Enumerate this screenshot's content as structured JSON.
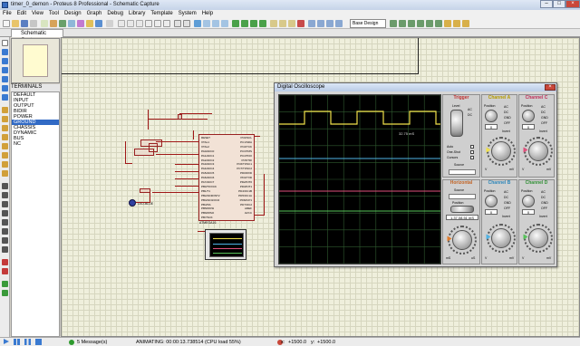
{
  "window": {
    "title": "timer_0_demon - Proteus 8 Professional - Schematic Capture"
  },
  "menu": [
    "File",
    "Edit",
    "View",
    "Tool",
    "Design",
    "Graph",
    "Debug",
    "Library",
    "Template",
    "System",
    "Help"
  ],
  "toolbar": {
    "design_select": "Base Design"
  },
  "tabs": {
    "active": "Schematic Capture"
  },
  "device_panel": {
    "header": "TERMINALS",
    "items": [
      "DEFAULT",
      "INPUT",
      "OUTPUT",
      "BIDIR",
      "POWER",
      "GROUND",
      "CHASSIS",
      "DYNAMIC",
      "BUS",
      "NC"
    ],
    "selected_index": 5
  },
  "schematic": {
    "chip_label": "ATMEGA16",
    "led_label": "LED-BLUE",
    "pins_left": [
      "RESET",
      "XTAL1",
      "XTAL2",
      "PA0/ADC0",
      "PA1/ADC1",
      "PA2/ADC2",
      "PA3/ADC3",
      "PA4/ADC4",
      "PA5/ADC5",
      "PA6/ADC6",
      "PA7/ADC7",
      "PB0/T0/XCK",
      "PB1/T1",
      "PB2/AIN0/INT2",
      "PB3/AIN1/OC0",
      "PB4/SS",
      "PB5/MOSI",
      "PB6/MISO",
      "PB7/SCK"
    ],
    "pins_right": [
      "PC0/SCL",
      "PC1/SDA",
      "PC2/TCK",
      "PC3/TMS",
      "PC4/TDO",
      "PC5/TDI",
      "PC6/TOSC1",
      "PC7/TOSC2",
      "PD0/RXD",
      "PD1/TXD",
      "PD2/INT0",
      "PD3/INT1",
      "PD4/OC1B",
      "PD5/OC1A",
      "PD6/ICP1",
      "PD7/OC2",
      "AREF",
      "AVCC"
    ]
  },
  "oscilloscope": {
    "title": "Digital Oscilloscope",
    "trace_readout": "32.75 mS",
    "channel_a": {
      "title": "Channel A",
      "position_label": "Position",
      "position_value": "0",
      "coupling": [
        "AC",
        "DC",
        "GND",
        "OFF"
      ],
      "invert": "Invert",
      "volts_value": "2",
      "volts_unit": "V",
      "volts_small_unit": "mV",
      "color": "#f0e04a"
    },
    "channel_b": {
      "title": "Channel B",
      "position_value": "0",
      "color": "#4fb3e6"
    },
    "channel_c": {
      "title": "Channel C",
      "position_value": "0",
      "color": "#e04f7b"
    },
    "channel_d": {
      "title": "Channel D",
      "position_value": "0",
      "color": "#57c35a"
    },
    "trigger": {
      "title": "Trigger",
      "level_label": "Level",
      "modes": [
        "Auto",
        "One-Shot",
        "Cursors"
      ],
      "source_label": "Source"
    },
    "horizontal": {
      "title": "Horizontal",
      "source_label": "Source",
      "position_label": "Position",
      "position_value": "1.37.08.51 mS",
      "time_unit": "mS",
      "time_small_unit": "uS"
    }
  },
  "status": {
    "messages": "5 Message(s)",
    "animation": "ANIMATING: 00:00:13.738514 (CPU load 55%)",
    "coords_x": "+1500.0",
    "coords_y": "+1500.0",
    "x_label": "x:",
    "y_label": "y:"
  },
  "colors": {
    "trace_a": "#f0e04a",
    "trace_b": "#4fb3e6",
    "trace_c": "#e04f7b",
    "trace_d": "#57c35a",
    "wire": "#a01818",
    "selection": "#316ac5"
  }
}
